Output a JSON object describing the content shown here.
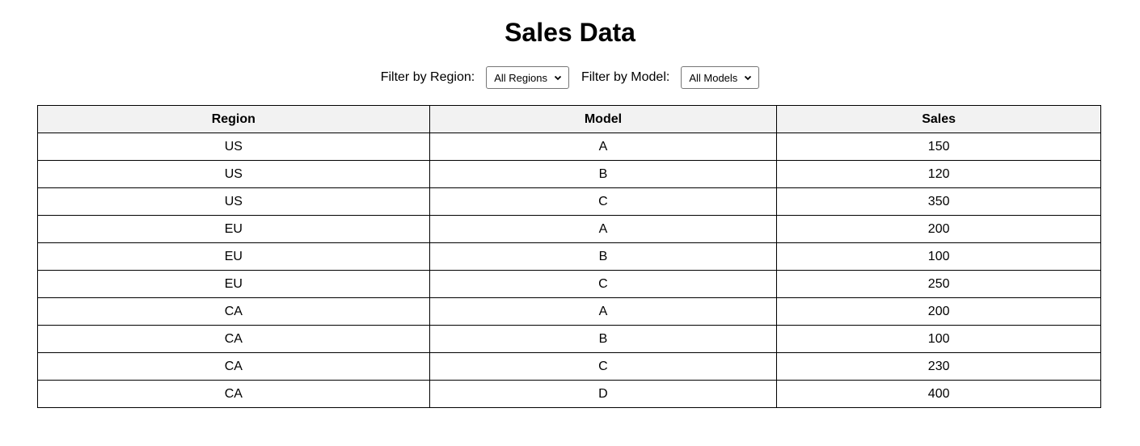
{
  "page": {
    "title": "Sales Data"
  },
  "filters": {
    "region_label": "Filter by Region:",
    "region_selected": "All Regions",
    "model_label": "Filter by Model:",
    "model_selected": "All Models"
  },
  "table": {
    "headers": [
      "Region",
      "Model",
      "Sales"
    ],
    "rows": [
      [
        "US",
        "A",
        "150"
      ],
      [
        "US",
        "B",
        "120"
      ],
      [
        "US",
        "C",
        "350"
      ],
      [
        "EU",
        "A",
        "200"
      ],
      [
        "EU",
        "B",
        "100"
      ],
      [
        "EU",
        "C",
        "250"
      ],
      [
        "CA",
        "A",
        "200"
      ],
      [
        "CA",
        "B",
        "100"
      ],
      [
        "CA",
        "C",
        "230"
      ],
      [
        "CA",
        "D",
        "400"
      ]
    ]
  },
  "icons": {
    "dropdown": "chevron-down-icon"
  }
}
